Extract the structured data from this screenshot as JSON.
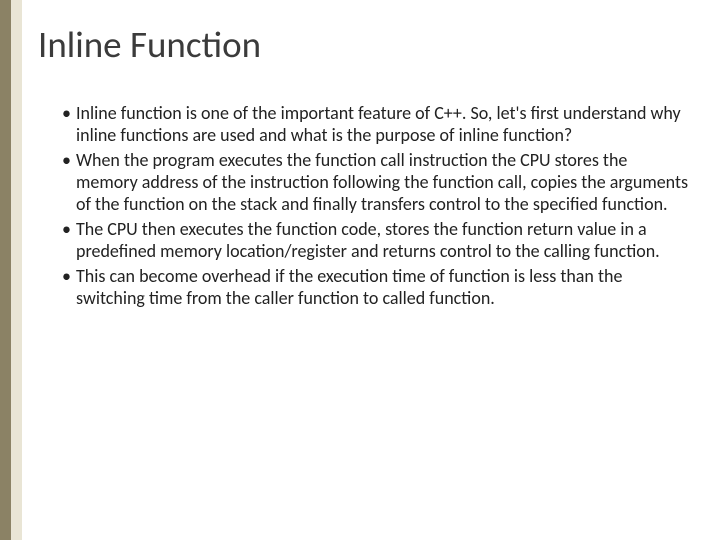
{
  "slide": {
    "title": "Inline Function",
    "bullets": [
      "Inline function is one of the important feature of C++. So, let's first understand why inline functions are used and what is the purpose of inline function?",
      "When the program executes the function call instruction the CPU stores the memory address of the instruction following the function call, copies the arguments of the function on the stack and finally transfers control to the specified function.",
      "The CPU then executes the function code, stores the function return value in a predefined memory location/register and returns control to the calling function.",
      " This can become overhead if the execution time of function is less than the switching time from the caller function to called function."
    ]
  },
  "theme": {
    "accent_outer": "#8b8265",
    "accent_inner": "#e9e5d5"
  }
}
